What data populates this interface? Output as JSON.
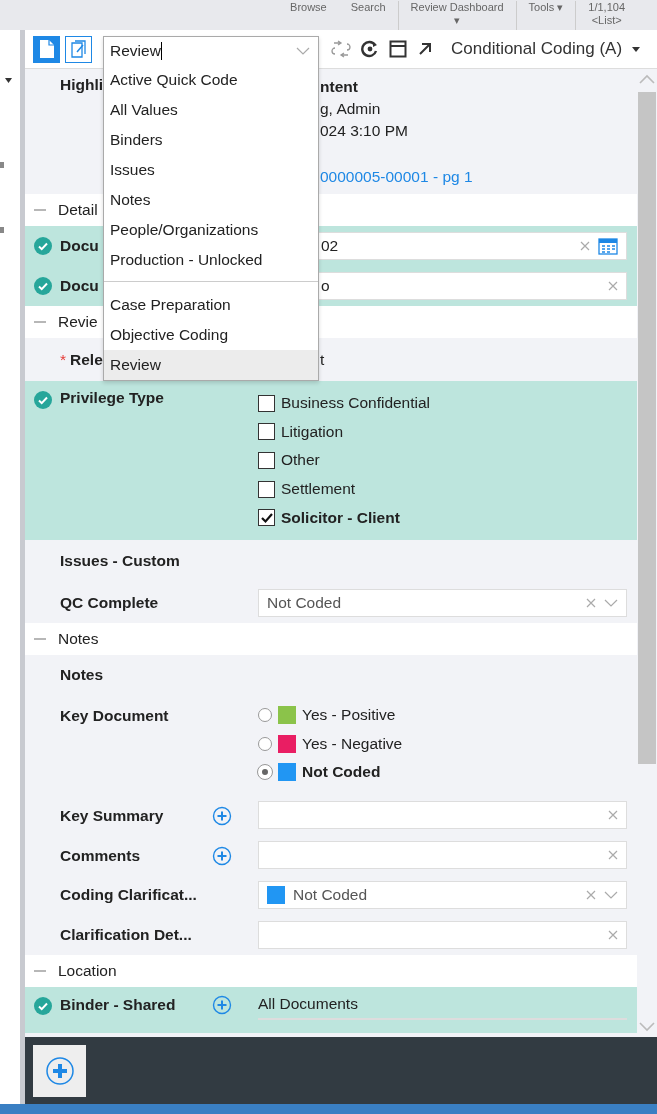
{
  "top_nav": [
    {
      "label": "Browse"
    },
    {
      "label": "Search"
    },
    {
      "label": "Review Dashboard",
      "sub": "▾"
    },
    {
      "label": "Tools ▾"
    },
    {
      "label": "1/1,104",
      "sub": "<List>"
    }
  ],
  "toolbar": {
    "panel_title": "Conditional Coding (A)"
  },
  "layout_dropdown": {
    "value": "Review",
    "groups": [
      [
        {
          "label": "Active Quick Code",
          "selected": false
        },
        {
          "label": "All Values",
          "selected": false
        },
        {
          "label": "Binders",
          "selected": false
        },
        {
          "label": "Issues",
          "selected": false
        },
        {
          "label": "Notes",
          "selected": false
        },
        {
          "label": "People/Organizations",
          "selected": false
        },
        {
          "label": "Production - Unlocked",
          "selected": false
        }
      ],
      [
        {
          "label": "Case Preparation",
          "selected": false
        },
        {
          "label": "Objective Coding",
          "selected": false
        },
        {
          "label": "Review",
          "selected": true
        }
      ]
    ]
  },
  "rows": [
    {
      "kind": "info",
      "label": "Highli",
      "lines": [
        {
          "text": "ntent",
          "kind": "bold"
        },
        {
          "text": "g, Admin",
          "kind": "plain"
        },
        {
          "text": "024 3:10 PM",
          "kind": "plain"
        },
        {
          "text": "0000005-00001 - pg 1",
          "kind": "link"
        }
      ]
    },
    {
      "kind": "section",
      "label": "Detail",
      "expanded": true
    },
    {
      "kind": "field",
      "label": "Docu",
      "coded": true,
      "value": "02",
      "calendar": true
    },
    {
      "kind": "field",
      "label": "Docu",
      "coded": true,
      "value": "o",
      "calendar": false
    },
    {
      "kind": "section",
      "label": "Revie",
      "expanded": true
    },
    {
      "kind": "text",
      "label": "Rele",
      "marker": "*",
      "value": "t"
    },
    {
      "kind": "checkboxes",
      "label": "Privilege Type",
      "coded": true,
      "options": [
        {
          "label": "Business Confidential",
          "checked": false
        },
        {
          "label": "Litigation",
          "checked": false
        },
        {
          "label": "Other",
          "checked": false
        },
        {
          "label": "Settlement",
          "checked": false
        },
        {
          "label": "Solicitor - Client",
          "checked": true
        }
      ]
    },
    {
      "kind": "label",
      "label": "Issues - Custom"
    },
    {
      "kind": "select",
      "label": "QC Complete",
      "value": "Not Coded"
    },
    {
      "kind": "section",
      "label": "Notes",
      "expanded": true
    },
    {
      "kind": "add",
      "label": "Notes"
    },
    {
      "kind": "radios",
      "label": "Key Document",
      "options": [
        {
          "label": "Yes - Positive",
          "color": "#8bc34a",
          "selected": false
        },
        {
          "label": "Yes - Negative",
          "color": "#e91e63",
          "selected": false
        },
        {
          "label": "Not Coded",
          "color": "#2196f3",
          "selected": true
        }
      ]
    },
    {
      "kind": "field",
      "label": "Key Summary",
      "add": true
    },
    {
      "kind": "field",
      "label": "Comments",
      "add": true
    },
    {
      "kind": "select",
      "label": "Coding Clarificat...",
      "value": "Not Coded",
      "color": "#2196f3"
    },
    {
      "kind": "field",
      "label": "Clarification Det..."
    },
    {
      "kind": "section",
      "label": "Location",
      "expanded": true
    },
    {
      "kind": "list",
      "label": "Binder - Shared",
      "coded": true,
      "add": true,
      "values": [
        "All Documents"
      ]
    }
  ]
}
